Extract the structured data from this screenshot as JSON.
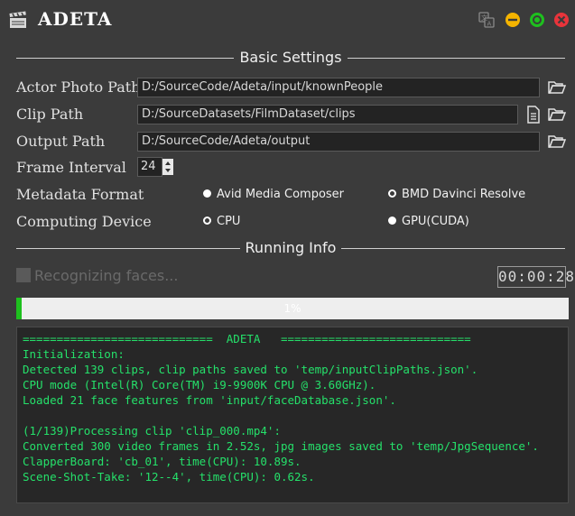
{
  "app": {
    "title": "ADETA"
  },
  "sections": {
    "basic": "Basic Settings",
    "running": "Running Info"
  },
  "settings": {
    "actor_photo": {
      "label": "Actor Photo Path",
      "value": "D:/SourceCode/Adeta/input/knownPeople"
    },
    "clip": {
      "label": "Clip Path",
      "value": "D:/SourceDatasets/FilmDataset/clips"
    },
    "output": {
      "label": "Output Path",
      "value": "D:/SourceCode/Adeta/output"
    },
    "frame_interval": {
      "label": "Frame Interval",
      "value": "24"
    },
    "metadata": {
      "label": "Metadata Format",
      "options": [
        {
          "label": "Avid Media Composer",
          "selected": true
        },
        {
          "label": "BMD Davinci Resolve",
          "selected": false
        }
      ]
    },
    "device": {
      "label": "Computing Device",
      "options": [
        {
          "label": "CPU",
          "selected": false
        },
        {
          "label": "GPU(CUDA)",
          "selected": true
        }
      ]
    }
  },
  "running": {
    "status": "Recognizing faces...",
    "timer": "00:00:28",
    "progress_percent": 1,
    "progress_label": "1%"
  },
  "console": {
    "lines": [
      "============================  ADETA   ============================",
      "Initialization:",
      "Detected 139 clips, clip paths saved to 'temp/inputClipPaths.json'.",
      "CPU mode (Intel(R) Core(TM) i9-9900K CPU @ 3.60GHz).",
      "Loaded 21 face features from 'input/faceDatabase.json'.",
      "",
      "(1/139)Processing clip 'clip_000.mp4':",
      "Converted 300 video frames in 2.52s, jpg images saved to 'temp/JpgSequence'.",
      "ClapperBoard: 'cb_01', time(CPU): 10.89s.",
      "Scene-Shot-Take: '12--4', time(CPU): 0.62s."
    ]
  },
  "colors": {
    "background": "#3b3b3b",
    "console_text": "#25e06a",
    "progress_fill": "#1ec01e",
    "minimize": "#f5b400",
    "maximize": "#1ec01e",
    "close": "#e8343b"
  },
  "icons": {
    "app": "clapperboard-icon",
    "translate": "translate-icon",
    "minimize": "minimize-icon",
    "maximize": "maximize-icon",
    "close": "close-icon",
    "folder": "folder-open-icon",
    "document": "document-icon",
    "status": "status-box-icon"
  }
}
